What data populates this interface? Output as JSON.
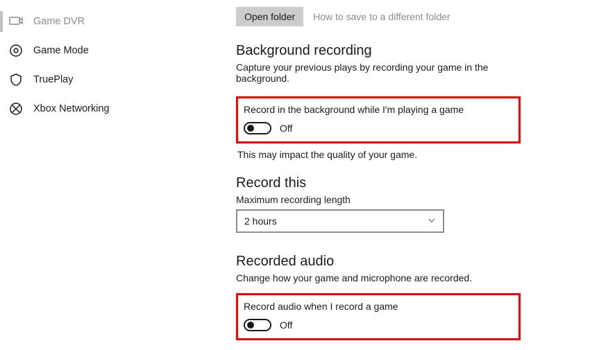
{
  "sidebar": {
    "items": [
      {
        "label": "Game DVR",
        "active": true
      },
      {
        "label": "Game Mode",
        "active": false
      },
      {
        "label": "TruePlay",
        "active": false
      },
      {
        "label": "Xbox Networking",
        "active": false
      }
    ]
  },
  "top": {
    "open_folder": "Open folder",
    "hint": "How to save to a different folder"
  },
  "sections": {
    "background": {
      "title": "Background recording",
      "sub": "Capture your previous plays by recording your game in the background.",
      "toggle_label": "Record in the background while I'm playing a game",
      "toggle_state": "Off",
      "impact": "This may impact the quality of your game."
    },
    "record_this": {
      "title": "Record this",
      "field_label": "Maximum recording length",
      "selected": "2 hours"
    },
    "audio": {
      "title": "Recorded audio",
      "sub": "Change how your game and microphone are recorded.",
      "toggle_label": "Record audio when I record a game",
      "toggle_state": "Off"
    }
  }
}
